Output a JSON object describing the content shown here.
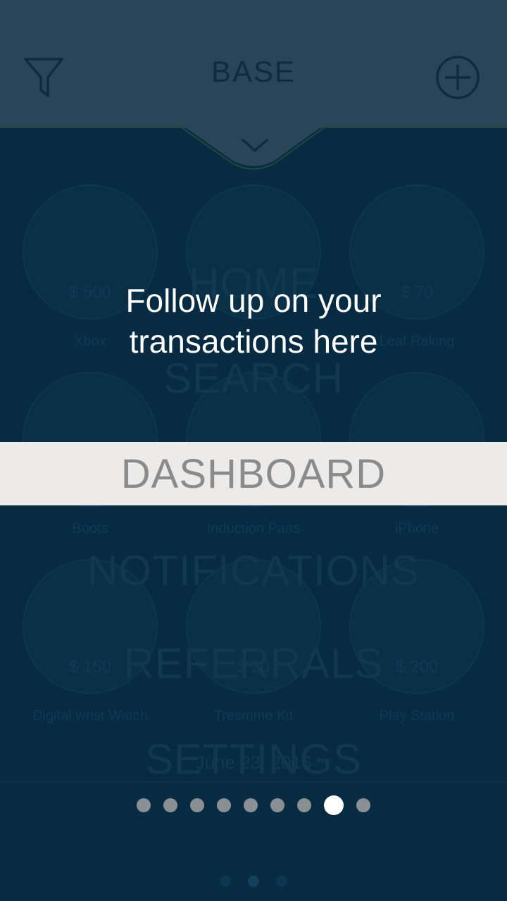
{
  "app": {
    "title": "BASE",
    "colors": {
      "header": "#294659",
      "background": "#072b42",
      "highlight": "#ecebea",
      "accent_dot": "#ffffff"
    }
  },
  "header": {
    "filter_icon": "filter-icon",
    "add_icon": "add-circle-icon",
    "expand_icon": "chevron-down-icon"
  },
  "items": [
    {
      "price": "$ 500",
      "name": "Xbox"
    },
    {
      "price": "",
      "name": ""
    },
    {
      "price": "$ 70",
      "name": "Leaf Raking"
    },
    {
      "price": "",
      "name": "Boots"
    },
    {
      "price": "",
      "name": "Induction Pans"
    },
    {
      "price": "",
      "name": "iPhone"
    },
    {
      "price": "$ 150",
      "name": "Digital wrist Watch"
    },
    {
      "price": "$ 20",
      "name": "Tresmme Kit"
    },
    {
      "price": "$ 200",
      "name": "Play Station"
    }
  ],
  "date_label": "June 23, 2016",
  "menu": {
    "home": "HOME",
    "search": "SEARCH",
    "dashboard": "DASHBOARD",
    "notifications": "NOTIFICATIONS",
    "referrals": "REFERRALS",
    "settings": "SETTINGS"
  },
  "onboarding": {
    "tip_line1": "Follow up on your",
    "tip_line2": "transactions here",
    "highlight_label": "DASHBOARD",
    "page_count": 9,
    "active_page": 8
  }
}
